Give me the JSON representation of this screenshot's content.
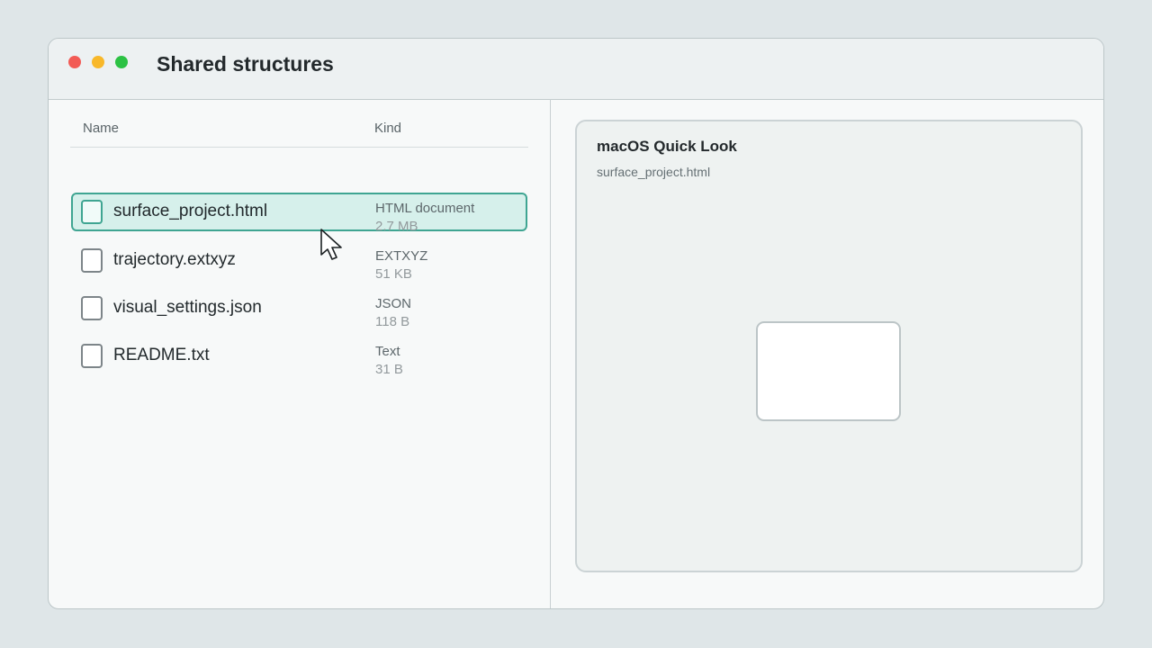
{
  "window": {
    "title": "Shared structures"
  },
  "columns": {
    "name": "Name",
    "kind": "Kind"
  },
  "files": [
    {
      "name": "surface_project.html",
      "kind": "HTML document",
      "size": "2.7 MB",
      "selected": true
    },
    {
      "name": "trajectory.extxyz",
      "kind": "EXTXYZ",
      "size": "51 KB",
      "selected": false
    },
    {
      "name": "visual_settings.json",
      "kind": "JSON",
      "size": "118 B",
      "selected": false
    },
    {
      "name": "README.txt",
      "kind": "Text",
      "size": "31 B",
      "selected": false
    }
  ],
  "preview": {
    "title": "macOS Quick Look",
    "filename": "surface_project.html"
  },
  "colors": {
    "accent": "#3fa592",
    "selection_bg": "#d6f0eb",
    "close": "#f25b55",
    "minimize": "#f8b82a",
    "zoom": "#2cc244"
  },
  "icons": {
    "file": "file-icon",
    "cursor": "mouse-pointer-icon"
  }
}
